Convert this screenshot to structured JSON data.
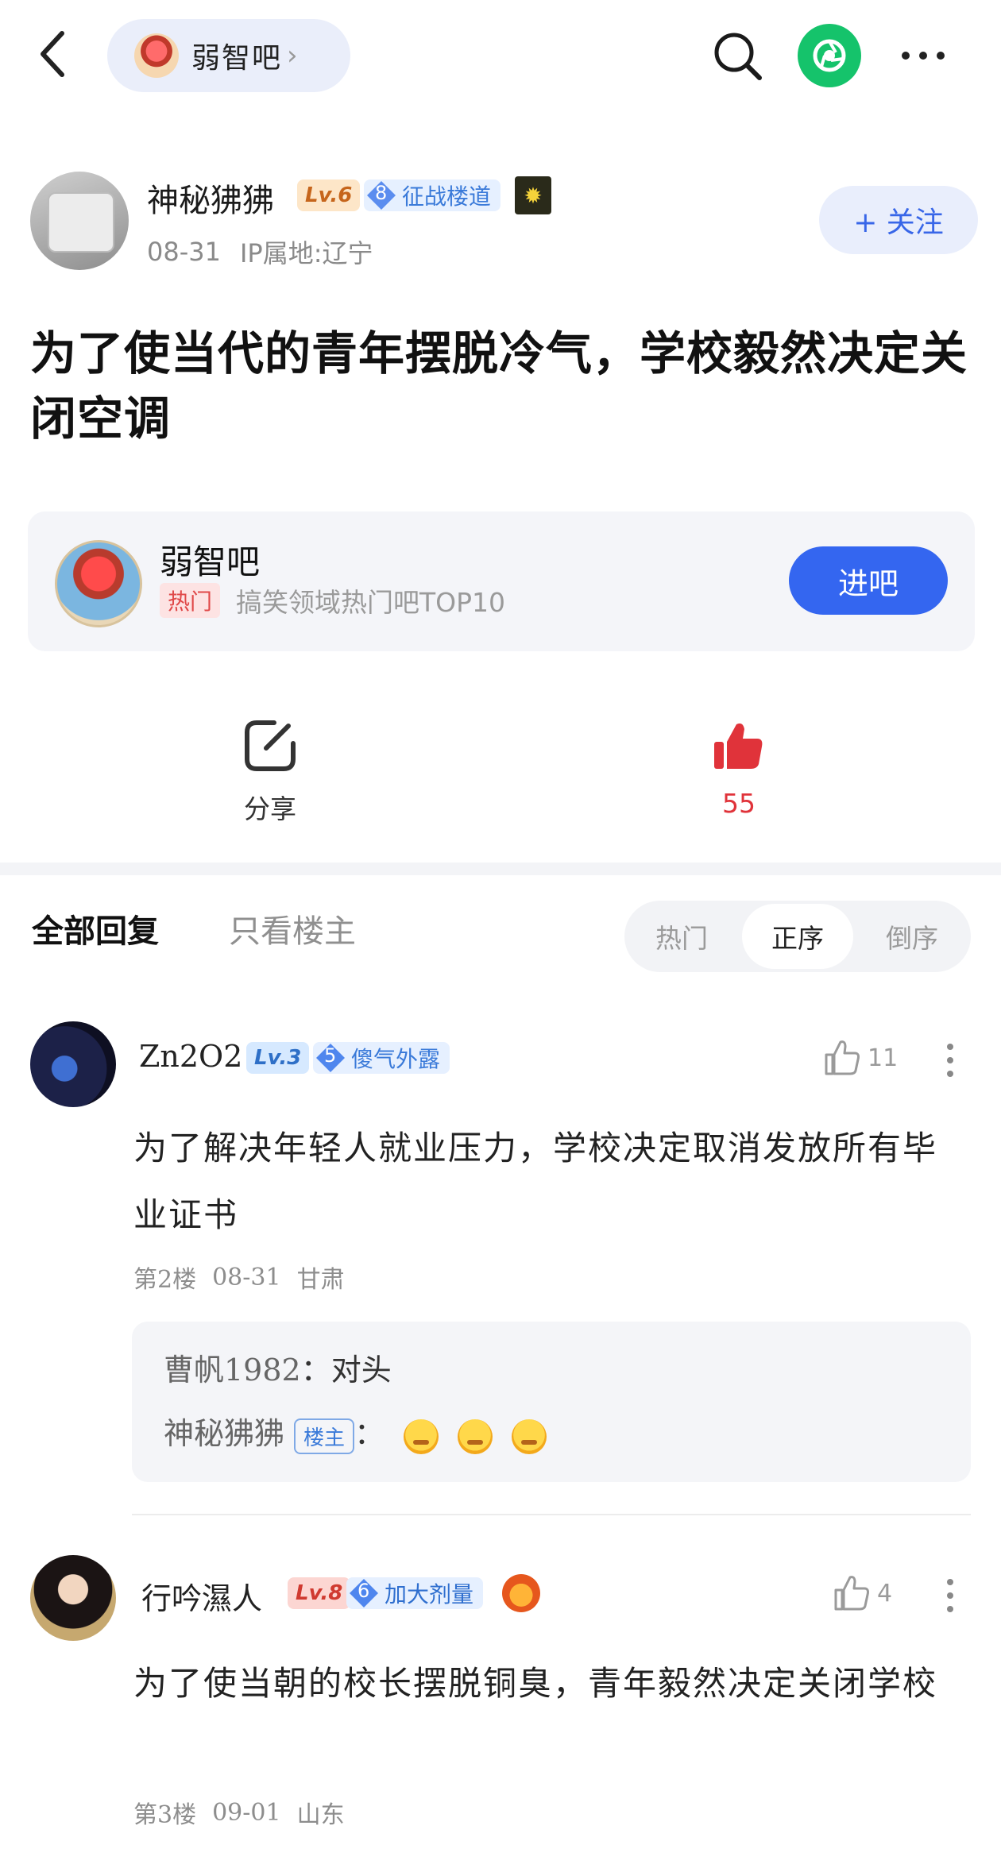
{
  "topbar": {
    "forum_name": "弱智吧",
    "chevron": "›"
  },
  "post": {
    "author": {
      "name": "神秘狒狒",
      "level": "Lv.6",
      "title_rank": "8",
      "title": "征战楼道",
      "date": "08-31",
      "ip": "IP属地:辽宁"
    },
    "follow_label": "+ 关注",
    "title": "为了使当代的青年摆脱冷气，学校毅然决定关闭空调"
  },
  "forum_card": {
    "name": "弱智吧",
    "tag": "热门",
    "description": "搞笑领域热门吧TOP10",
    "enter_label": "进吧"
  },
  "actions": {
    "share_label": "分享",
    "like_count": "55",
    "like_color": "#e0333a"
  },
  "replies": {
    "tab_all": "全部回复",
    "tab_owner_only": "只看楼主",
    "sort": {
      "hot": "热门",
      "asc": "正序",
      "desc": "倒序",
      "selected": "正序"
    },
    "comments": [
      {
        "user": "Zn2O2",
        "level": "Lv.3",
        "title_rank": "5",
        "title": "傻气外露",
        "likes": "11",
        "text": "为了解决年轻人就业压力，学校决定取消发放所有毕业证书",
        "floor": "第2楼",
        "date": "08-31",
        "location": "甘肃",
        "sub_replies": [
          {
            "user": "曹帆1982",
            "sep": "：",
            "text": "对头"
          },
          {
            "user": "神秘狒狒",
            "tag": "楼主",
            "sep": "："
          }
        ]
      },
      {
        "user": "行吟濕人",
        "level": "Lv.8",
        "title_rank": "6",
        "title": "加大剂量",
        "likes": "4",
        "text": "为了使当朝的校长摆脱铜臭，青年毅然决定关闭学校",
        "floor": "第3楼",
        "date": "09-01",
        "location": "山东"
      }
    ]
  },
  "icons": {
    "back": "chevron-left-icon",
    "search": "search-icon",
    "share_app": "share-shutter-icon",
    "more": "more-horizontal-icon",
    "share": "share-arrow-icon",
    "like": "thumbs-up-icon"
  },
  "colors": {
    "accent_blue": "#3466f0",
    "wechat_green": "#15c36b",
    "hot_red": "#e04848"
  }
}
